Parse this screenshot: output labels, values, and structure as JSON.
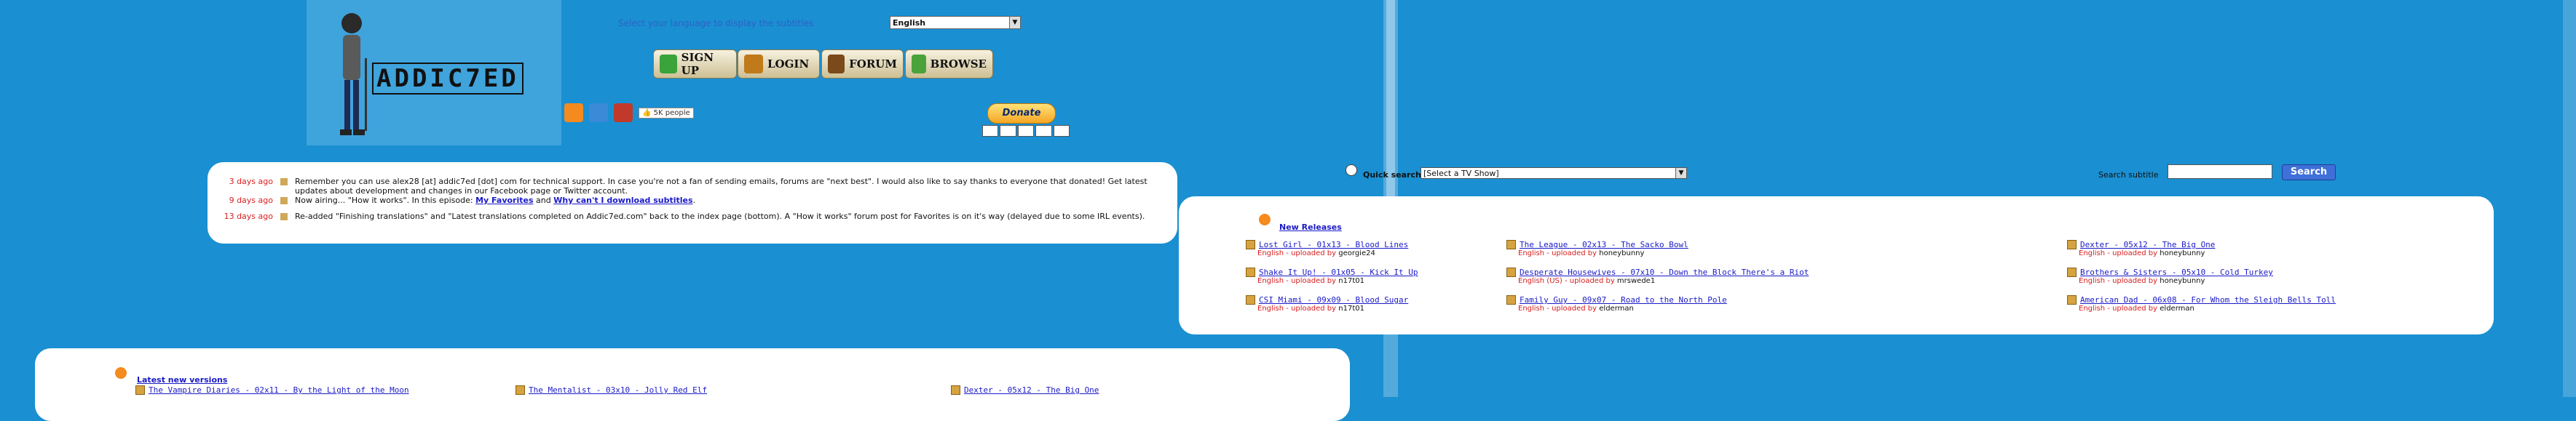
{
  "header": {
    "logo_text": "ADDIC7ED",
    "language_prompt": "Select your language to display the subtitles",
    "language_value": "English",
    "nav": [
      {
        "label": "SIGN UP",
        "icon": "signup-icon",
        "color": "#3aa33a"
      },
      {
        "label": "LOGIN",
        "icon": "login-icon",
        "color": "#c07a1a"
      },
      {
        "label": "FORUM",
        "icon": "forum-icon",
        "color": "#7a4a1a"
      },
      {
        "label": "BROWSE",
        "icon": "browse-icon",
        "color": "#4aa33a"
      }
    ],
    "donate_label": "Donate",
    "social": [
      {
        "icon": "rss-icon",
        "color": "#f58a1f"
      },
      {
        "icon": "twitter-icon",
        "color": "#3a8ad8"
      },
      {
        "icon": "facebook-icon",
        "color": "#c0392b"
      }
    ],
    "like_label": "5K people"
  },
  "news": [
    {
      "when": "3 days ago",
      "text": "Remember you can use alex28 [at] addic7ed [dot] com for technical support. In case you're not a fan of sending emails, forums are \"next best\". I would also like to say thanks to everyone that donated! Get latest updates about development and changes in our Facebook page or Twitter account."
    },
    {
      "when": "9 days ago",
      "text": "Now airing... \"How it works\". In this episode: ",
      "link1": "My Favorites",
      "mid": " and ",
      "link2": "Why can't I download subtitles",
      "tail": "."
    },
    {
      "when": "13 days ago",
      "text": "Re-added \"Finishing translations\" and \"Latest translations completed on Addic7ed.com\" back to the index page (bottom). A \"How it works\" forum post for Favorites is on it's way (delayed due to some IRL events)."
    }
  ],
  "search": {
    "quick_label": "Quick search",
    "show_placeholder": "[Select a TV Show]",
    "subtitle_label": "Search subtitle",
    "button": "Search"
  },
  "new_releases": {
    "title": "New Releases",
    "items": [
      {
        "title": "Lost Girl - 01x13 - Blood Lines",
        "lang": "English",
        "by": "georgie24"
      },
      {
        "title": "The League - 02x13 - The Sacko Bowl",
        "lang": "English",
        "by": "honeybunny"
      },
      {
        "title": "Dexter - 05x12 - The Big One",
        "lang": "English",
        "by": "honeybunny"
      },
      {
        "title": "Shake It Up! - 01x05 - Kick It Up",
        "lang": "English",
        "by": "n17t01"
      },
      {
        "title": "Desperate Housewives - 07x10 - Down the Block There's a Riot",
        "lang": "English (US)",
        "by": "mrswede1"
      },
      {
        "title": "Brothers & Sisters - 05x10 - Cold Turkey",
        "lang": "English",
        "by": "honeybunny"
      },
      {
        "title": "CSI Miami - 09x09 - Blood Sugar",
        "lang": "English",
        "by": "n17t01"
      },
      {
        "title": "Family Guy - 09x07 - Road to the North Pole",
        "lang": "English",
        "by": "elderman"
      },
      {
        "title": "American Dad - 06x08 - For Whom the Sleigh Bells Toll",
        "lang": "English",
        "by": "elderman"
      }
    ]
  },
  "latest_versions": {
    "title": "Latest new versions",
    "items": [
      {
        "title": "The Vampire Diaries - 02x11 - By the Light of the Moon"
      },
      {
        "title": "The Mentalist - 03x10 - Jolly Red Elf"
      },
      {
        "title": "Dexter - 05x12 - The Big One"
      }
    ]
  },
  "uploaded_by_text": " - uploaded by ",
  "colors": {
    "background": "#1a8fd1",
    "panel": "#ffffff",
    "link": "#1a1ac8",
    "red": "#d81e1e"
  }
}
